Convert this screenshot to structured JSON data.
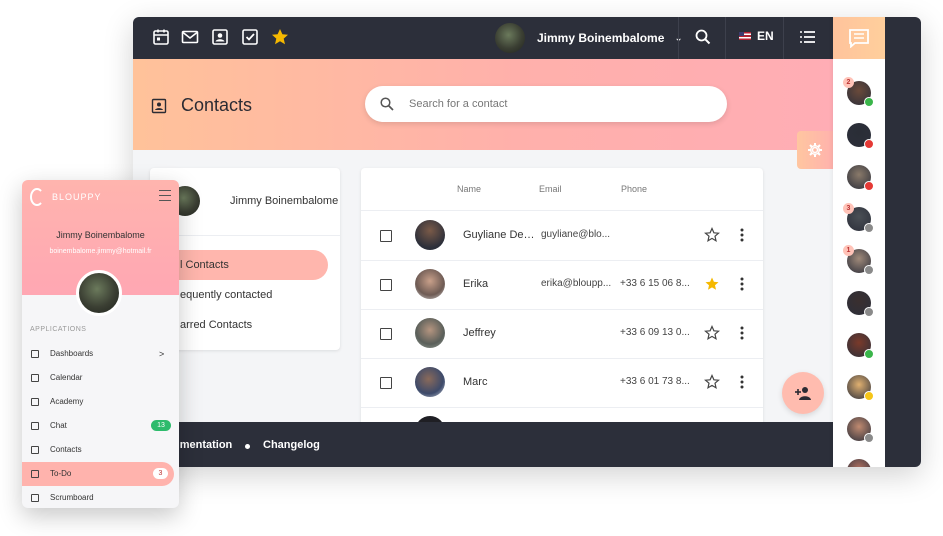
{
  "topbar": {
    "icons": [
      "calendar-icon",
      "mail-icon",
      "contacts-icon",
      "checkbox-icon",
      "star-icon"
    ],
    "user_name": "Jimmy Boinembalome",
    "language": "EN"
  },
  "header": {
    "title": "Contacts",
    "search_placeholder": "Search for a contact"
  },
  "left_panel": {
    "user_name": "Jimmy Boinembalome",
    "nav": [
      {
        "label": "l Contacts",
        "active": true
      },
      {
        "label": "equently contacted",
        "active": false
      },
      {
        "label": "arred Contacts",
        "active": false
      }
    ]
  },
  "table": {
    "columns": [
      "Name",
      "Email",
      "Phone"
    ],
    "rows": [
      {
        "name": "Guyliane De J...",
        "email": "guyliane@blo...",
        "phone": "",
        "starred": false
      },
      {
        "name": "Erika",
        "email": "erika@bloupp...",
        "phone": "+33 6 15 06 8...",
        "starred": true
      },
      {
        "name": "Jeffrey",
        "email": "",
        "phone": "+33 6 09 13 0...",
        "starred": false
      },
      {
        "name": "Marc",
        "email": "",
        "phone": "+33 6 01 73 8...",
        "starred": false
      }
    ]
  },
  "footer": {
    "link1": "umentation",
    "link2": "Changelog"
  },
  "sidebar_contacts": [
    {
      "badge": "2",
      "status": "#3ab54a"
    },
    {
      "badge": "",
      "status": "#e53935"
    },
    {
      "badge": "",
      "status": "#e53935"
    },
    {
      "badge": "3",
      "status": "#8a8a8a"
    },
    {
      "badge": "1",
      "status": "#8a8a8a"
    },
    {
      "badge": "",
      "status": "#8a8a8a"
    },
    {
      "badge": "",
      "status": "#3ab54a"
    },
    {
      "badge": "",
      "status": "#f5c518"
    },
    {
      "badge": "",
      "status": "#8a8a8a"
    },
    {
      "badge": "",
      "status": "#8a8a8a"
    }
  ],
  "mobile": {
    "brand": "BLOUPPY",
    "user_name": "Jimmy Boinembalome",
    "user_email": "boinembalome.jimmy@hotmail.fr",
    "section": "APPLICATIONS",
    "items": [
      {
        "label": "Dashboards",
        "badge": "",
        "arrow": ">"
      },
      {
        "label": "Calendar",
        "badge": "",
        "arrow": ""
      },
      {
        "label": "Academy",
        "badge": "",
        "arrow": ""
      },
      {
        "label": "Chat",
        "badge": "13",
        "arrow": ""
      },
      {
        "label": "Contacts",
        "badge": "",
        "arrow": ""
      },
      {
        "label": "To-Do",
        "badge": "3",
        "arrow": ""
      },
      {
        "label": "Scrumboard",
        "badge": "",
        "arrow": ""
      }
    ]
  },
  "colors": {
    "dark": "#2c2f3a",
    "accent": "#ffb4ae",
    "star_active": "#f5b800"
  }
}
